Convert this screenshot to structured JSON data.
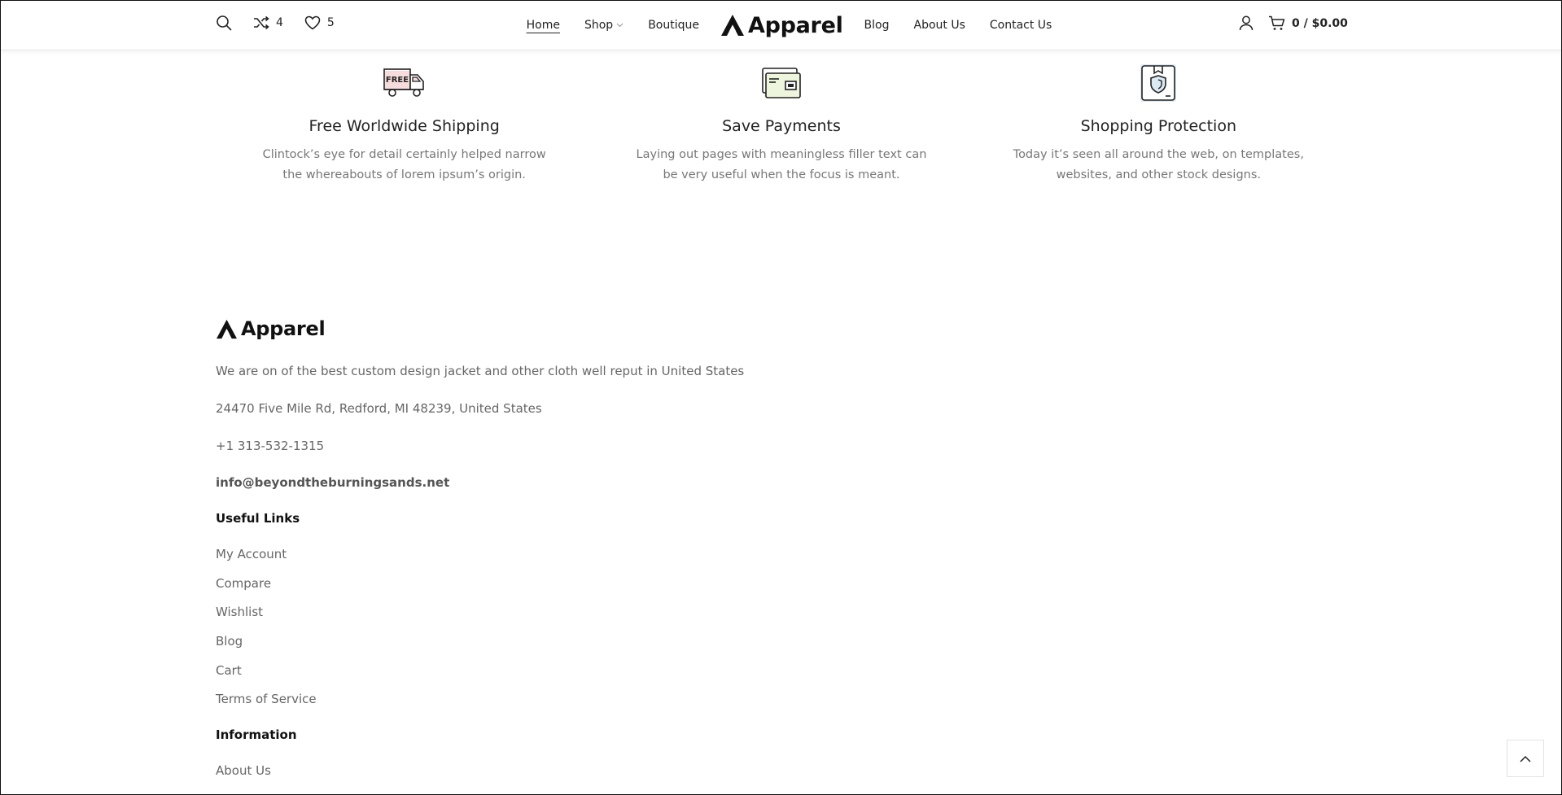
{
  "header": {
    "compare_count": "4",
    "wishlist_count": "5",
    "nav": {
      "home": "Home",
      "shop": "Shop",
      "boutique": "Boutique",
      "brand": "Apparel",
      "blog": "Blog",
      "about": "About Us",
      "contact": "Contact Us"
    },
    "cart_label": "0 / $0.00"
  },
  "features": [
    {
      "icon": "free-delivery-truck-icon",
      "title": "Free Worldwide Shipping",
      "desc": "Clintock’s eye for detail certainly helped narrow the whereabouts of lorem ipsum’s origin.",
      "truck_text": "FREE"
    },
    {
      "icon": "credit-card-icon",
      "title": "Save Payments",
      "desc": "Laying out pages with meaningless filler text can be very useful when the focus is meant."
    },
    {
      "icon": "shield-box-icon",
      "title": "Shopping Protection",
      "desc": "Today it’s seen all around the web, on templates, websites, and other stock designs."
    }
  ],
  "footer": {
    "brand": "Apparel",
    "about": "We are on of the best custom design jacket and other cloth well reput in United States",
    "address": "24470 Five Mile Rd, Redford, MI 48239, United States",
    "phone": "+1 313-532-1315",
    "email": "info@beyondtheburningsands.net",
    "useful_links_heading": "Useful Links",
    "useful_links": [
      "My Account",
      "Compare",
      "Wishlist",
      "Blog",
      "Cart",
      "Terms of Service"
    ],
    "information_heading": "Information",
    "information_links": [
      "About Us"
    ]
  },
  "colors": {
    "text": "#222222",
    "muted": "#777777",
    "truck_accent": "#f6dcdc",
    "card_accent": "#eef5dd",
    "shield_accent": "#dbe9f3"
  }
}
